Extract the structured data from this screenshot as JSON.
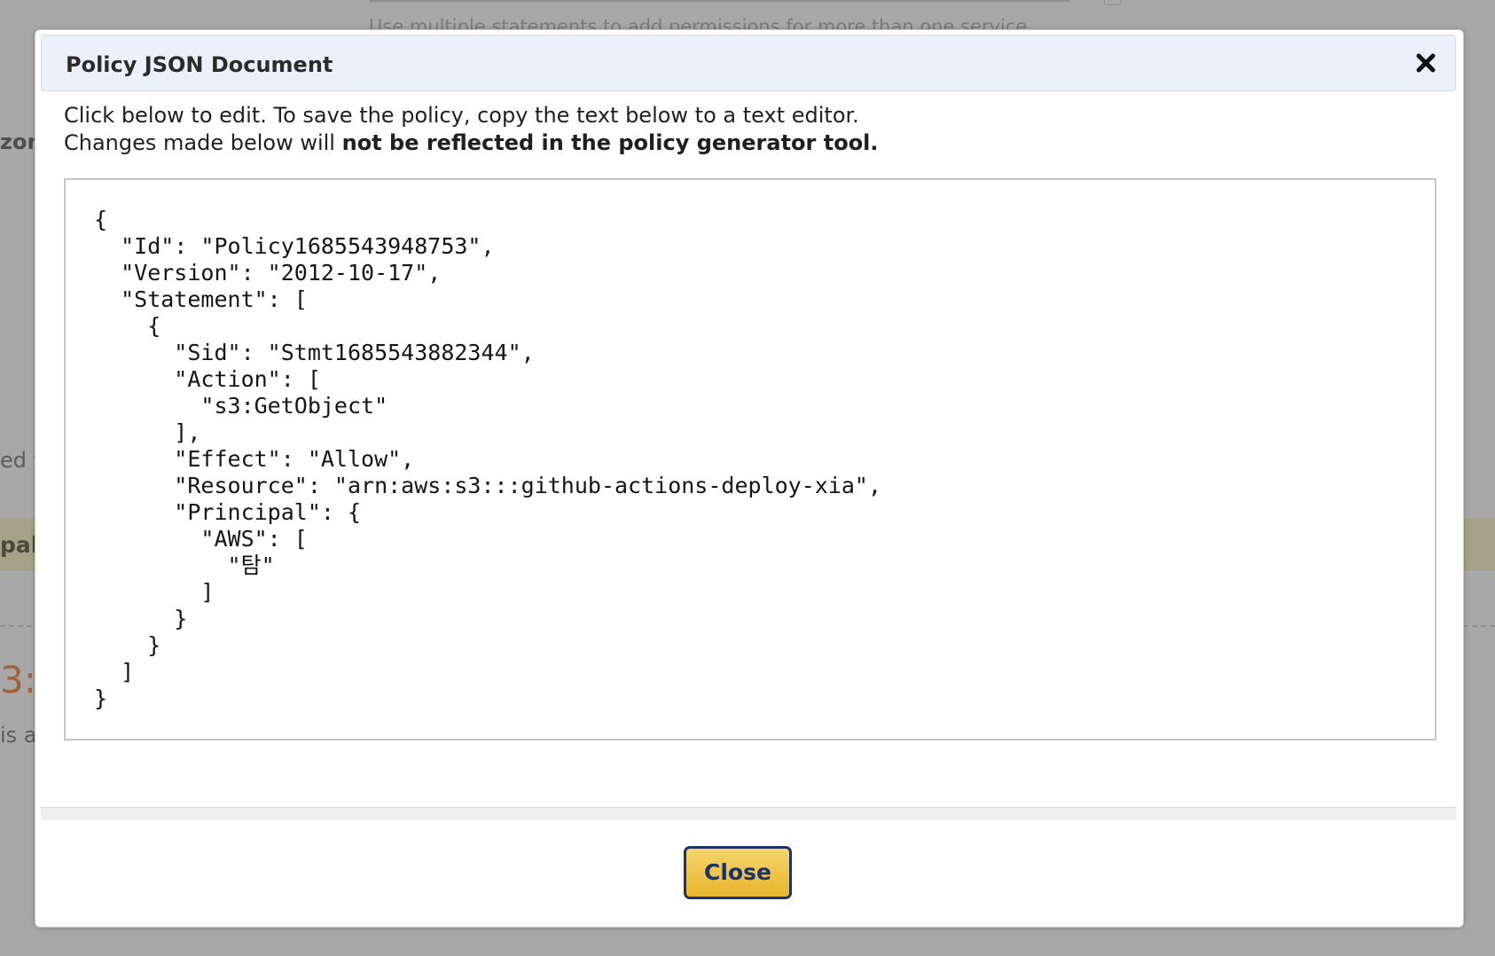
{
  "background": {
    "hint": "Use multiple statements to add permissions for more than one service",
    "fragment_1": "zon",
    "fragment_2": "ed t",
    "fragment_3": "pal",
    "fragment_4": "3:",
    "fragment_5": "is a"
  },
  "modal": {
    "title": "Policy JSON Document",
    "close_icon": "close-icon",
    "instructions_line1": "Click below to edit. To save the policy, copy the text below to a text editor.",
    "instructions_line2_prefix": "Changes made below will ",
    "instructions_line2_bold": "not be reflected in the policy generator tool.",
    "policy_json": "{\n  \"Id\": \"Policy1685543948753\",\n  \"Version\": \"2012-10-17\",\n  \"Statement\": [\n    {\n      \"Sid\": \"Stmt1685543882344\",\n      \"Action\": [\n        \"s3:GetObject\"\n      ],\n      \"Effect\": \"Allow\",\n      \"Resource\": \"arn:aws:s3:::github-actions-deploy-xia\",\n      \"Principal\": {\n        \"AWS\": [\n          \"탐\"\n        ]\n      }\n    }\n  ]\n}",
    "close_button_label": "Close"
  },
  "colors": {
    "header_background": "#eaf1fb",
    "button_gold": "#e8b52d",
    "button_border": "#1d3366"
  }
}
